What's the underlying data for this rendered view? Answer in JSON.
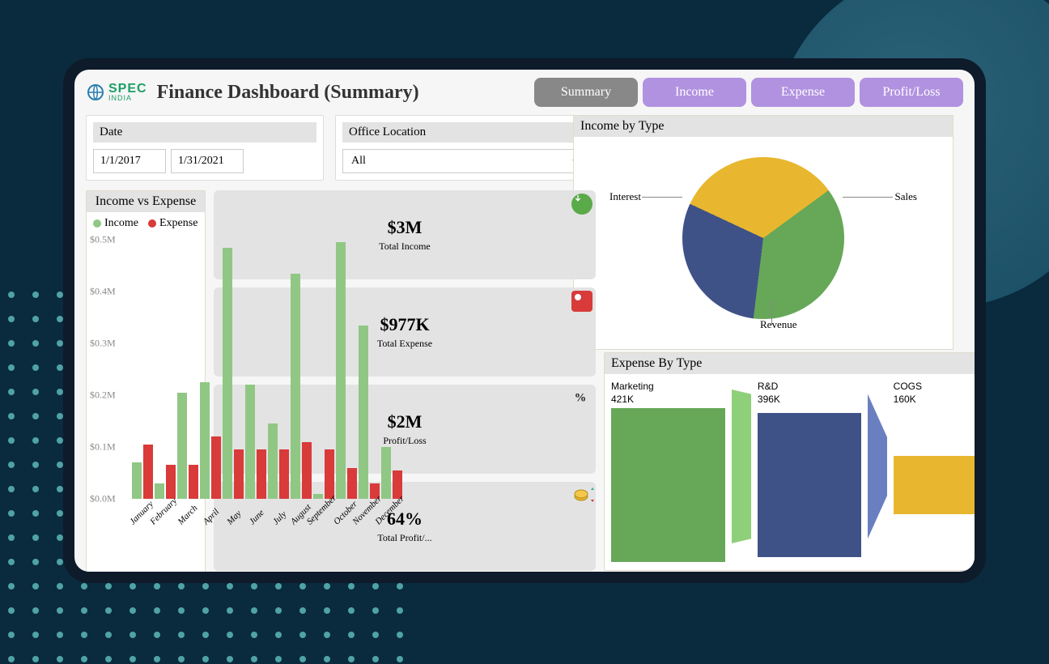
{
  "header": {
    "logo_brand_top": "SPEC",
    "logo_brand_bottom": "INDIA",
    "title": "Finance Dashboard (Summary)"
  },
  "tabs": [
    {
      "label": "Summary",
      "active": true
    },
    {
      "label": "Income",
      "active": false
    },
    {
      "label": "Expense",
      "active": false
    },
    {
      "label": "Profit/Loss",
      "active": false
    }
  ],
  "filters": {
    "date_label": "Date",
    "date_from": "1/1/2017",
    "date_to": "1/31/2021",
    "location_label": "Office Location",
    "location_value": "All"
  },
  "kpis": [
    {
      "value": "$3M",
      "label": "Total Income",
      "icon": "income-icon",
      "color": "green"
    },
    {
      "value": "$977K",
      "label": "Total Expense",
      "icon": "expense-icon",
      "color": "red"
    },
    {
      "value": "$2M",
      "label": "Profit/Loss",
      "icon": "percent-icon",
      "color": "dark"
    },
    {
      "value": "64%",
      "label": "Total Profit/...",
      "icon": "coins-icon",
      "color": "gold"
    }
  ],
  "income_vs_expense_title": "Income vs Expense",
  "legend_income": "Income",
  "legend_expense": "Expense",
  "income_by_type_title": "Income by Type",
  "expense_by_type_title": "Expense By Type",
  "pie_labels": {
    "interest": "Interest",
    "sales": "Sales",
    "revenue": "Revenue"
  },
  "funnel": [
    {
      "name": "Marketing",
      "value": "421K",
      "color": "#66a858"
    },
    {
      "name": "R&D",
      "value": "396K",
      "color": "#3f5288"
    },
    {
      "name": "COGS",
      "value": "160K",
      "color": "#e8b72f"
    }
  ],
  "y_ticks": [
    "$0.0M",
    "$0.1M",
    "$0.2M",
    "$0.3M",
    "$0.4M",
    "$0.5M"
  ],
  "chart_data": [
    {
      "type": "bar",
      "title": "Income vs Expense",
      "xlabel": "",
      "ylabel": "",
      "ylim": [
        0,
        0.5
      ],
      "y_unit": "M",
      "categories": [
        "January",
        "February",
        "March",
        "April",
        "May",
        "June",
        "July",
        "August",
        "September",
        "October",
        "November",
        "December"
      ],
      "series": [
        {
          "name": "Income",
          "color": "#90c784",
          "values": [
            0.07,
            0.03,
            0.205,
            0.225,
            0.485,
            0.22,
            0.145,
            0.435,
            0.01,
            0.495,
            0.335,
            0.1
          ]
        },
        {
          "name": "Expense",
          "color": "#d93a3a",
          "values": [
            0.105,
            0.065,
            0.065,
            0.12,
            0.095,
            0.095,
            0.095,
            0.11,
            0.095,
            0.06,
            0.03,
            0.055
          ]
        }
      ]
    },
    {
      "type": "pie",
      "title": "Income by Type",
      "series": [
        {
          "name": "Interest",
          "value": 33,
          "color": "#e8b72f"
        },
        {
          "name": "Sales",
          "value": 37,
          "color": "#66a858"
        },
        {
          "name": "Revenue",
          "value": 30,
          "color": "#3f5288"
        }
      ]
    },
    {
      "type": "bar",
      "title": "Expense By Type",
      "layout": "funnel",
      "series": [
        {
          "name": "Marketing",
          "value": 421,
          "unit": "K",
          "color": "#66a858"
        },
        {
          "name": "R&D",
          "value": 396,
          "unit": "K",
          "color": "#3f5288"
        },
        {
          "name": "COGS",
          "value": 160,
          "unit": "K",
          "color": "#e8b72f"
        }
      ]
    }
  ]
}
